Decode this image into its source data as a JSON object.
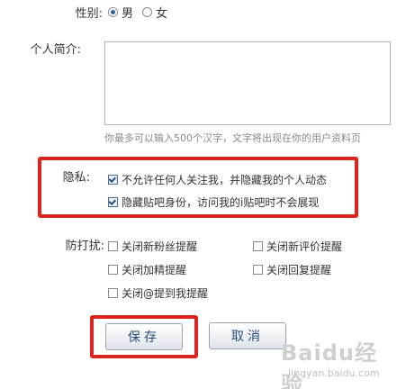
{
  "gender": {
    "label": "性别:",
    "options": [
      {
        "label": "男",
        "selected": true
      },
      {
        "label": "女",
        "selected": false
      }
    ]
  },
  "bio": {
    "label": "个人简介:",
    "value": "",
    "hint": "你最多可以输入500个汉字，文字将出现在你的用户资料页"
  },
  "privacy": {
    "label": "隐私:",
    "options": [
      {
        "label": "不允许任何人关注我，并隐藏我的个人动态",
        "checked": true
      },
      {
        "label": "隐藏贴吧身份，访问我的i贴吧时不会展现",
        "checked": true
      }
    ]
  },
  "disturb": {
    "label": "防打扰:",
    "options": [
      {
        "label": "关闭新粉丝提醒",
        "checked": false
      },
      {
        "label": "关闭新评价提醒",
        "checked": false
      },
      {
        "label": "关闭加精提醒",
        "checked": false
      },
      {
        "label": "关闭回复提醒",
        "checked": false
      },
      {
        "label": "关闭@提到我提醒",
        "checked": false
      }
    ]
  },
  "buttons": {
    "save": "保存",
    "cancel": "取消"
  },
  "watermark": {
    "brand": "Baidu经验",
    "url": "jingyan.baidu.com"
  },
  "colors": {
    "highlight": "#d9251d",
    "button_text": "#24497a"
  }
}
